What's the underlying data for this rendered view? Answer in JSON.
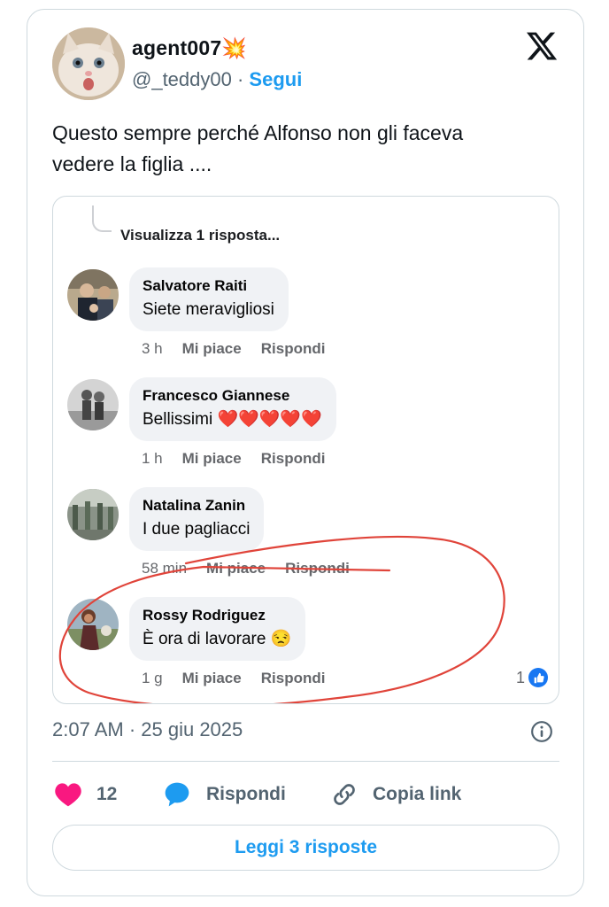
{
  "author": {
    "display_name": "agent007💥",
    "handle": "@_teddy00",
    "separator": " · ",
    "follow_label": "Segui"
  },
  "tweet": {
    "text": "Questo sempre perché Alfonso non gli faceva\nvedere la figlia ...."
  },
  "media": {
    "view_replies": "Visualizza 1 risposta...",
    "comments": [
      {
        "name": "Salvatore Raiti",
        "text": "Siete meravigliosi",
        "time": "3 h",
        "like": "Mi piace",
        "reply": "Rispondi"
      },
      {
        "name": "Francesco Giannese",
        "text": "Bellissimi ❤️❤️❤️❤️❤️",
        "time": "1 h",
        "like": "Mi piace",
        "reply": "Rispondi"
      },
      {
        "name": "Natalina Zanin",
        "text": "I due pagliacci",
        "time": "58 min",
        "like": "Mi piace",
        "reply": "Rispondi"
      },
      {
        "name": "Rossy Rodriguez",
        "text": "È ora di lavorare 😒",
        "time": "1 g",
        "like": "Mi piace",
        "reply": "Rispondi",
        "reactions": "1"
      }
    ],
    "annotation_color": "#e0443a"
  },
  "meta": {
    "timestamp": "2:07 AM · 25 giu 2025"
  },
  "actions": {
    "like_count": "12",
    "reply_label": "Rispondi",
    "copy_label": "Copia link",
    "read_replies": "Leggi 3 risposte"
  },
  "colors": {
    "accent": "#1d9bf0",
    "like": "#f91880",
    "fb_blue": "#1877f2"
  }
}
